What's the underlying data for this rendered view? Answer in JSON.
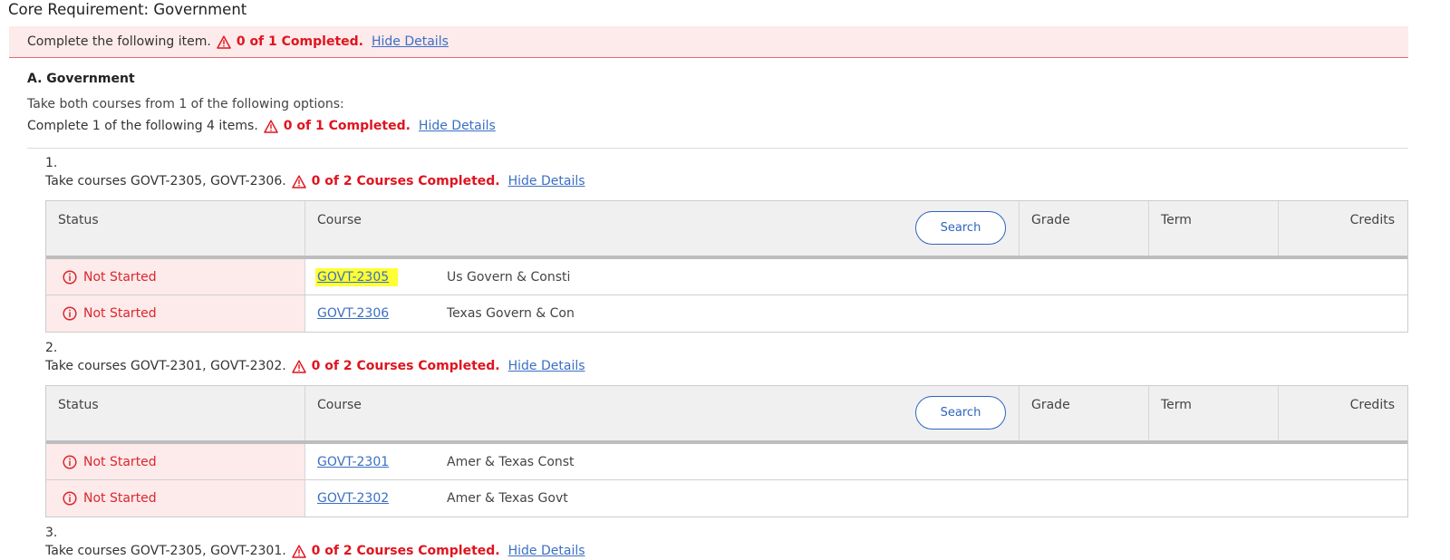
{
  "page": {
    "title": "Core Requirement: Government"
  },
  "banner": {
    "text": "Complete the following item.",
    "count": "0 of 1 Completed.",
    "link": "Hide Details"
  },
  "section": {
    "heading": "A. Government",
    "instruction": "Take both courses from 1 of the following options:",
    "status_text": "Complete 1 of the following 4 items.",
    "status_count": "0 of 1 Completed.",
    "status_link": "Hide Details"
  },
  "table_headers": {
    "status": "Status",
    "course": "Course",
    "search": "Search",
    "grade": "Grade",
    "term": "Term",
    "credits": "Credits"
  },
  "options": [
    {
      "number": "1.",
      "text": "Take courses GOVT-2305, GOVT-2306.",
      "count": "0 of 2 Courses Completed.",
      "link": "Hide Details",
      "rows": [
        {
          "status": "Not Started",
          "code": "GOVT-2305",
          "title": "Us Govern & Consti"
        },
        {
          "status": "Not Started",
          "code": "GOVT-2306",
          "title": "Texas Govern & Con"
        }
      ]
    },
    {
      "number": "2.",
      "text": "Take courses GOVT-2301, GOVT-2302.",
      "count": "0 of 2 Courses Completed.",
      "link": "Hide Details",
      "rows": [
        {
          "status": "Not Started",
          "code": "GOVT-2301",
          "title": "Amer & Texas Const"
        },
        {
          "status": "Not Started",
          "code": "GOVT-2302",
          "title": "Amer & Texas Govt"
        }
      ]
    },
    {
      "number": "3.",
      "text": "Take courses GOVT-2305, GOVT-2301.",
      "count": "0 of 2 Courses Completed.",
      "link": "Hide Details"
    }
  ],
  "colors": {
    "warning_red": "#e0141e",
    "banner_bg": "#fdeaea",
    "link_blue": "#3b6fc4",
    "highlight": "#ffff33"
  },
  "icons": {
    "warning": "warning-triangle-icon",
    "status": "info-circle-icon"
  }
}
